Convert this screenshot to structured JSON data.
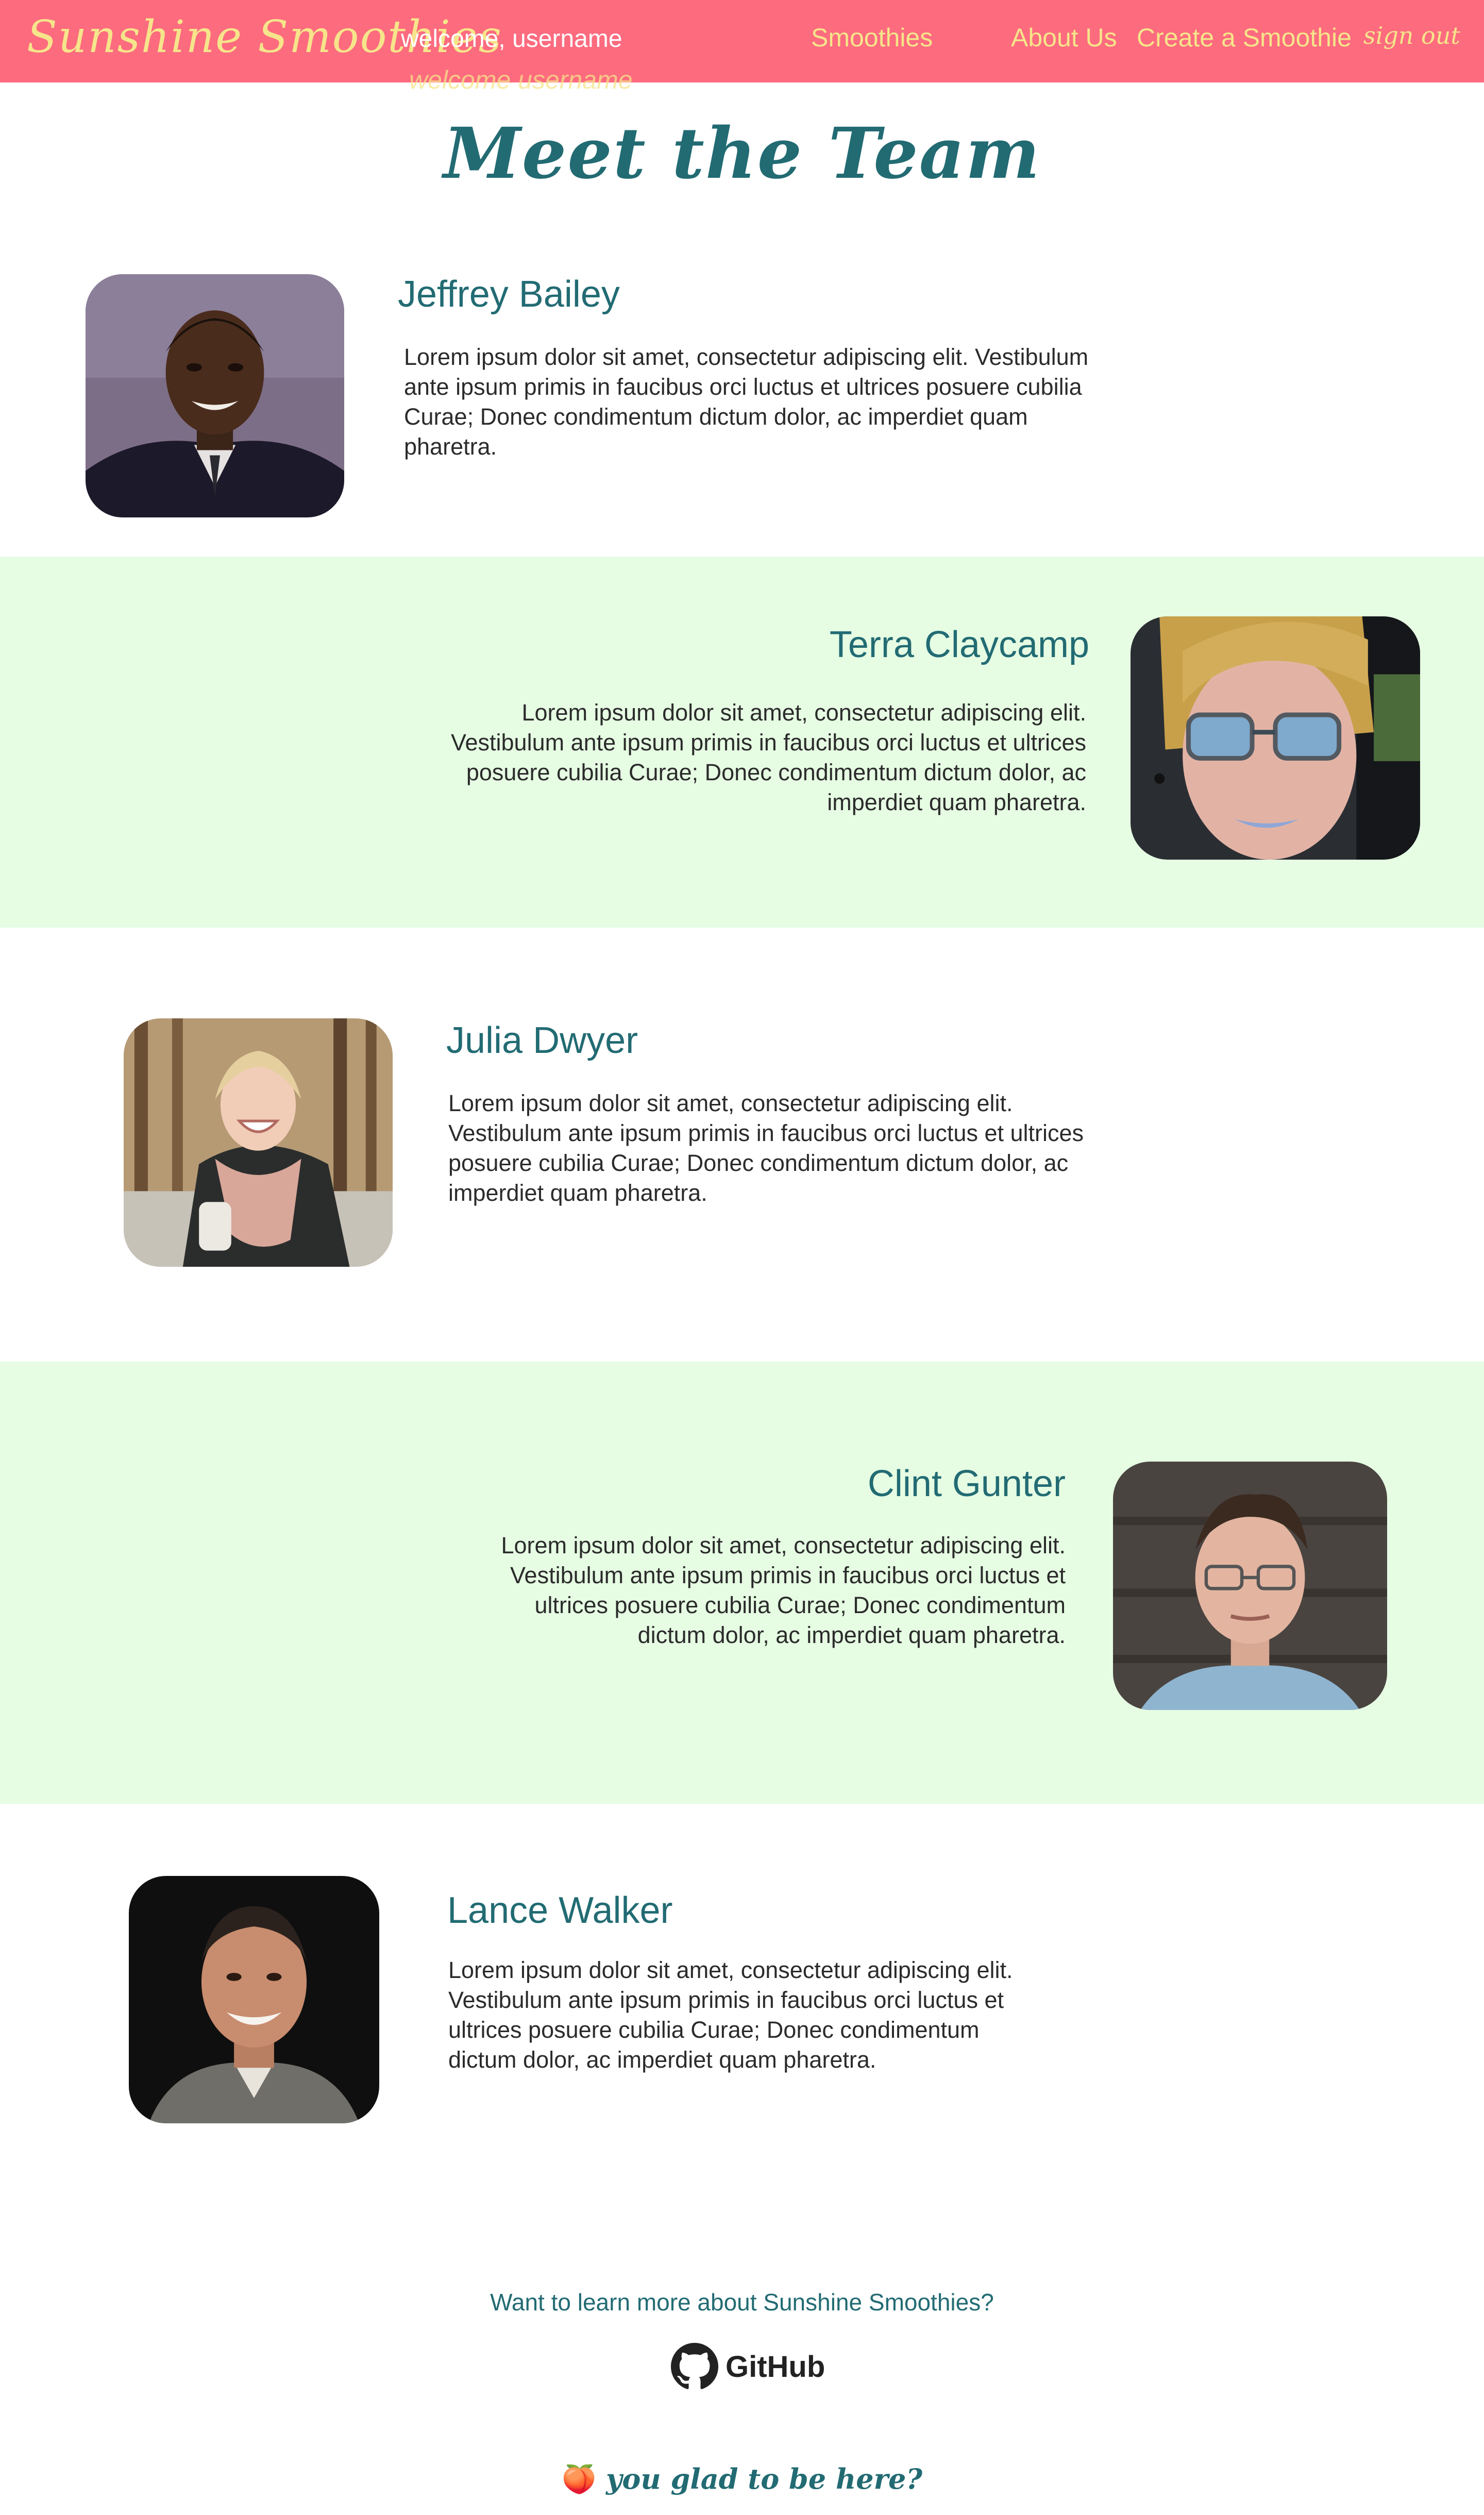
{
  "nav": {
    "brand": "Sunshine Smoothies",
    "welcome": "welcome, username",
    "ghost_welcome": "welcome username",
    "links": {
      "smoothies": "Smoothies",
      "about": "About Us",
      "create": "Create a Smoothie",
      "signout": "sign out"
    }
  },
  "page": {
    "title": "Meet the Team"
  },
  "team": [
    {
      "name": "Jeffrey Bailey",
      "bio": "Lorem ipsum dolor sit amet, consectetur adipiscing elit. Vestibulum ante ipsum primis in faucibus orci luctus et ultrices posuere cubilia Curae; Donec condimentum dictum dolor, ac imperdiet quam pharetra."
    },
    {
      "name": "Terra Claycamp",
      "bio": "Lorem ipsum dolor sit amet, consectetur adipiscing elit. Vestibulum ante ipsum primis in faucibus orci luctus et ultrices posuere cubilia Curae; Donec condimentum dictum dolor, ac imperdiet quam pharetra."
    },
    {
      "name": "Julia Dwyer",
      "bio": "Lorem ipsum dolor sit amet, consectetur adipiscing elit. Vestibulum ante ipsum primis in faucibus orci luctus et ultrices posuere cubilia Curae; Donec condimentum dictum dolor, ac imperdiet quam pharetra."
    },
    {
      "name": "Clint Gunter",
      "bio": "Lorem ipsum dolor sit amet, consectetur adipiscing elit. Vestibulum ante ipsum primis in faucibus orci luctus et ultrices posuere cubilia Curae; Donec condimentum dictum dolor, ac imperdiet quam pharetra."
    },
    {
      "name": "Lance Walker",
      "bio": "Lorem ipsum dolor sit amet, consectetur adipiscing elit. Vestibulum ante ipsum primis in faucibus orci luctus et ultrices posuere cubilia Curae; Donec condimentum dictum dolor, ac imperdiet quam pharetra."
    }
  ],
  "footer": {
    "learn_more": "Want to learn more about Sunshine Smoothies?",
    "github_label": "GitHub",
    "github_icon": "github-icon",
    "tagline_emoji": "🍑",
    "tagline": "you glad to be here?"
  },
  "colors": {
    "navbar": "#fd6b7f",
    "nav_text": "#f6e58a",
    "heading": "#226b73",
    "band": "#e6fde3"
  }
}
